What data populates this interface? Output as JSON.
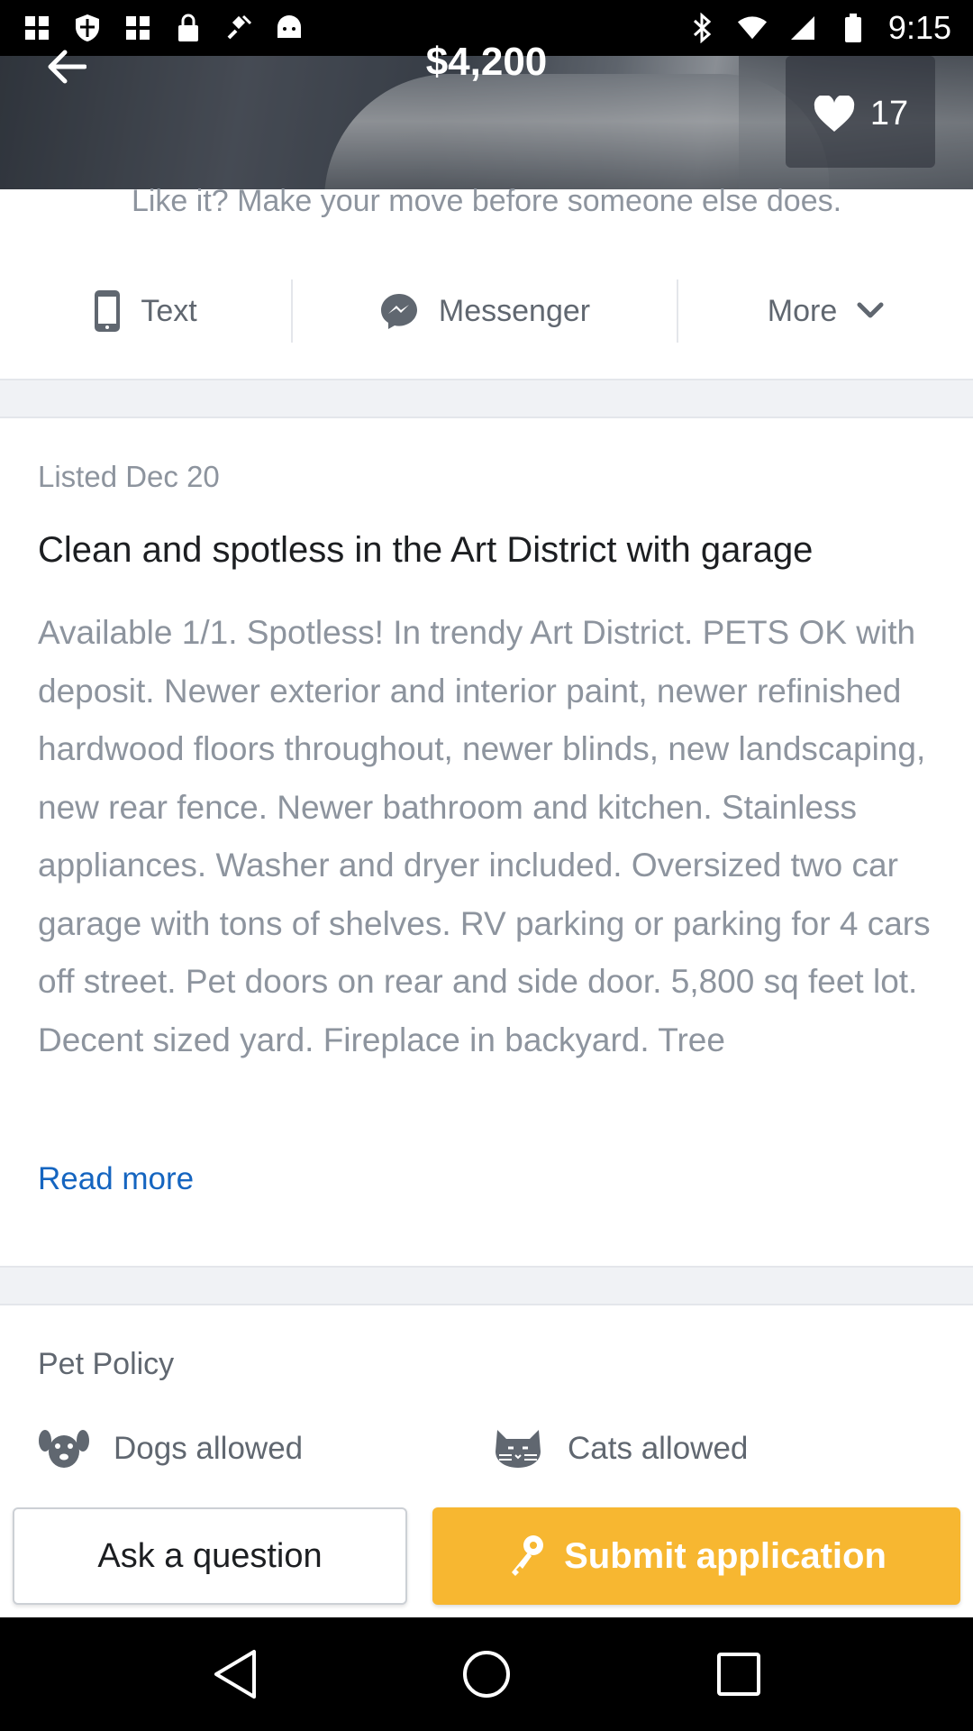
{
  "status_bar": {
    "time": "9:15",
    "left_icons": [
      "photos-icon",
      "shield-icon",
      "photos-icon",
      "lock-icon",
      "satellite-icon",
      "android-icon"
    ],
    "right_icons": [
      "bluetooth-icon",
      "wifi-icon",
      "signal-icon",
      "battery-icon"
    ]
  },
  "header": {
    "price": "$4,200",
    "like_count": "17"
  },
  "contact": {
    "teaser": "Like it? Make your move before someone else does.",
    "text_label": "Text",
    "messenger_label": "Messenger",
    "more_label": "More"
  },
  "listing": {
    "listed": "Listed Dec 20",
    "title": "Clean and spotless in the Art District with garage",
    "description": "Available 1/1. Spotless! In trendy Art District. PETS OK with deposit. Newer exterior and interior paint, newer refinished hardwood floors throughout, newer blinds, new landscaping, new rear fence. Newer bathroom and kitchen. Stainless appliances. Washer and dryer included. Oversized two car garage with tons of shelves. RV parking or parking for 4 cars off street. Pet doors on rear and side door. 5,800 sq feet lot. Decent sized yard. Fireplace in backyard. Tree",
    "read_more": "Read more"
  },
  "pet_policy": {
    "title": "Pet Policy",
    "dogs": "Dogs allowed",
    "cats": "Cats allowed"
  },
  "actions": {
    "ask": "Ask a question",
    "submit": "Submit application"
  },
  "colors": {
    "accent": "#f7b731",
    "link": "#1565c0",
    "muted_text": "#8d949e"
  }
}
